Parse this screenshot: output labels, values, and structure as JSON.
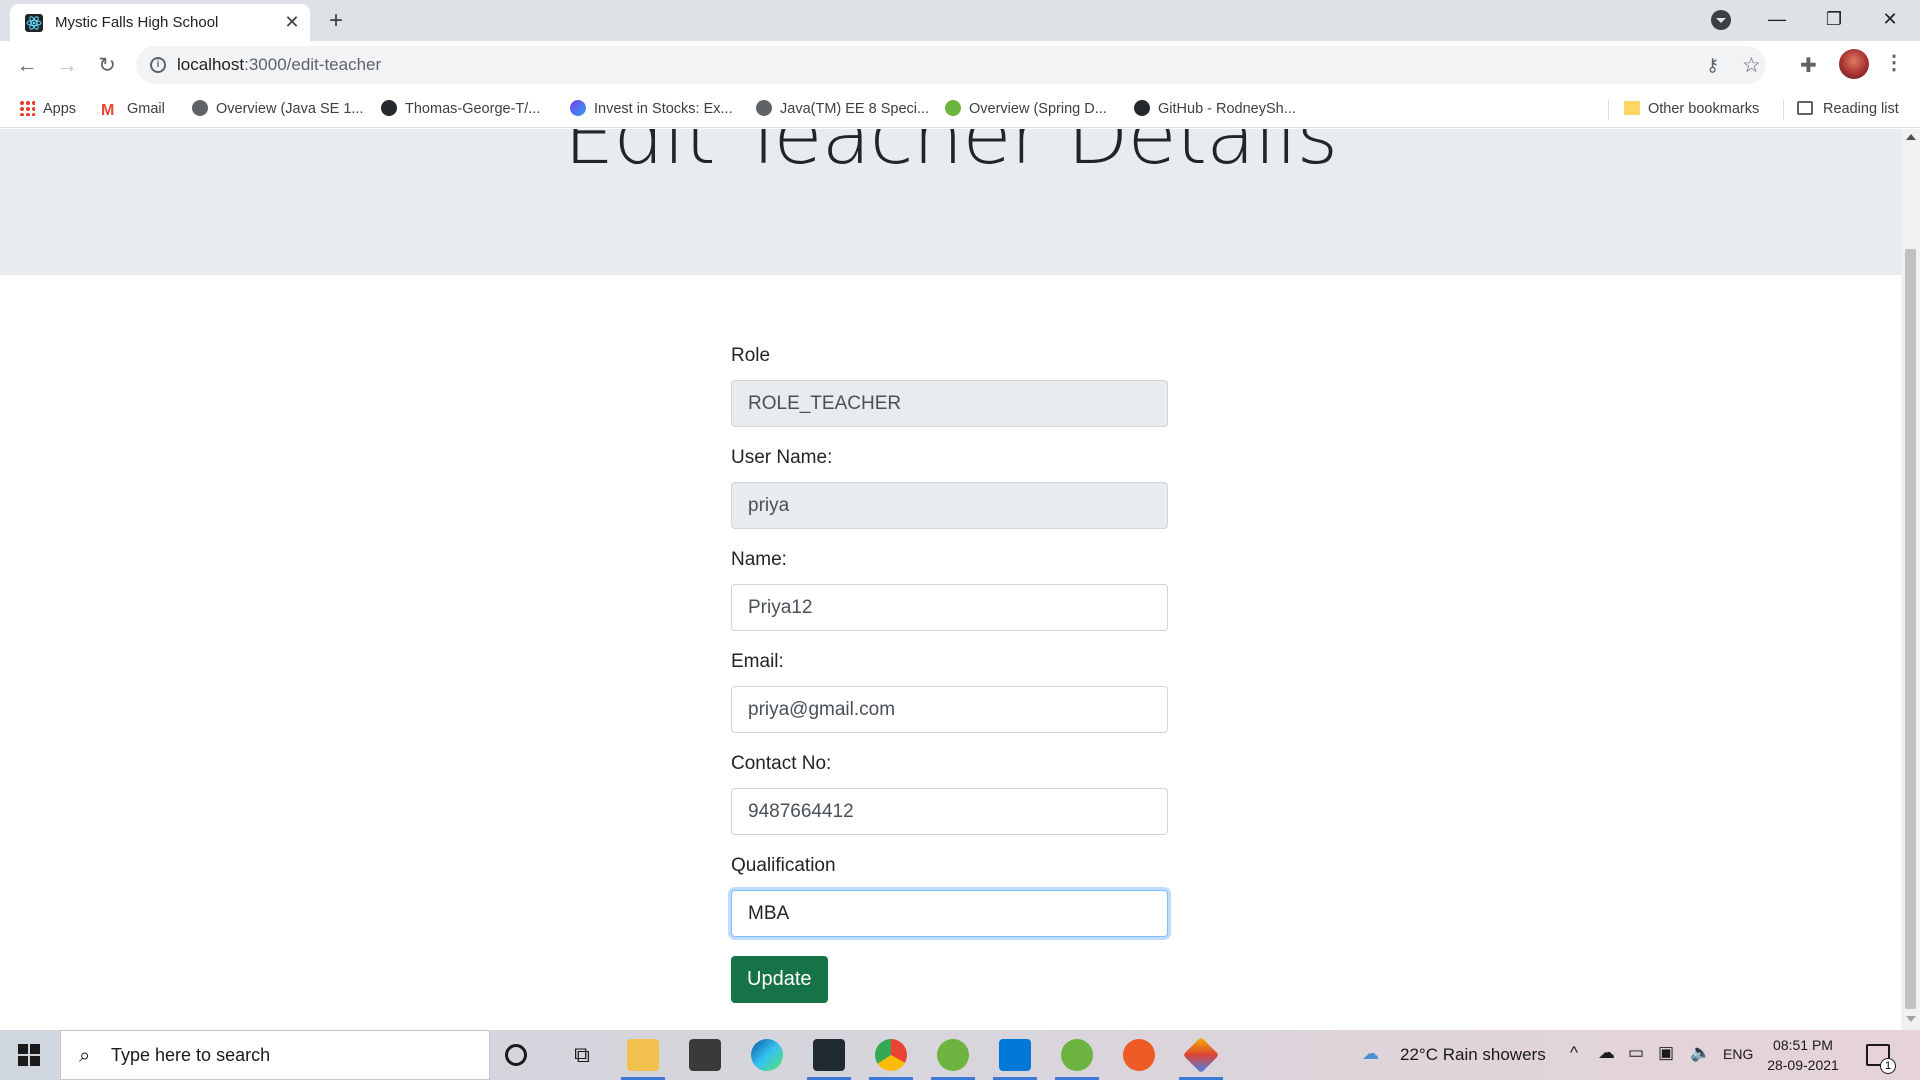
{
  "browser": {
    "tab_title": "Mystic Falls High School",
    "url_host": "localhost",
    "url_path": ":3000/edit-teacher",
    "window_controls": {
      "minimize": "—",
      "restore": "❐",
      "close": "✕"
    }
  },
  "bookmarks": [
    {
      "label": "Apps",
      "icon": "apps-grid-icon"
    },
    {
      "label": "Gmail",
      "icon": "gmail-icon"
    },
    {
      "label": "Overview (Java SE 1...",
      "icon": "globe-icon"
    },
    {
      "label": "Thomas-George-T/...",
      "icon": "github-icon"
    },
    {
      "label": "Invest in Stocks: Ex...",
      "icon": "invest-icon"
    },
    {
      "label": "Java(TM) EE 8 Speci...",
      "icon": "globe-icon"
    },
    {
      "label": "Overview (Spring D...",
      "icon": "spring-icon"
    },
    {
      "label": "GitHub - RodneySh...",
      "icon": "github-icon"
    }
  ],
  "bookmarks_right": {
    "other": "Other bookmarks",
    "reading": "Reading list"
  },
  "page": {
    "title": "Edit Teacher Details",
    "fields": [
      {
        "label": "Role",
        "value": "ROLE_TEACHER",
        "readonly": true
      },
      {
        "label": "User Name:",
        "value": "priya",
        "readonly": true
      },
      {
        "label": "Name:",
        "value": "Priya12",
        "readonly": false
      },
      {
        "label": "Email:",
        "value": "priya@gmail.com",
        "readonly": false
      },
      {
        "label": "Contact No:",
        "value": "9487664412",
        "readonly": false
      },
      {
        "label": "Qualification",
        "value": "MBA",
        "readonly": false,
        "focused": true
      }
    ],
    "submit_label": "Update",
    "colors": {
      "jumbotron": "#e9ecef",
      "button": "#157347",
      "focus_ring": "#80bdff"
    }
  },
  "taskbar": {
    "search_placeholder": "Type here to search",
    "weather": "22°C  Rain showers",
    "language": "ENG",
    "time": "08:51 PM",
    "date": "28-09-2021",
    "notification_count": "1"
  }
}
